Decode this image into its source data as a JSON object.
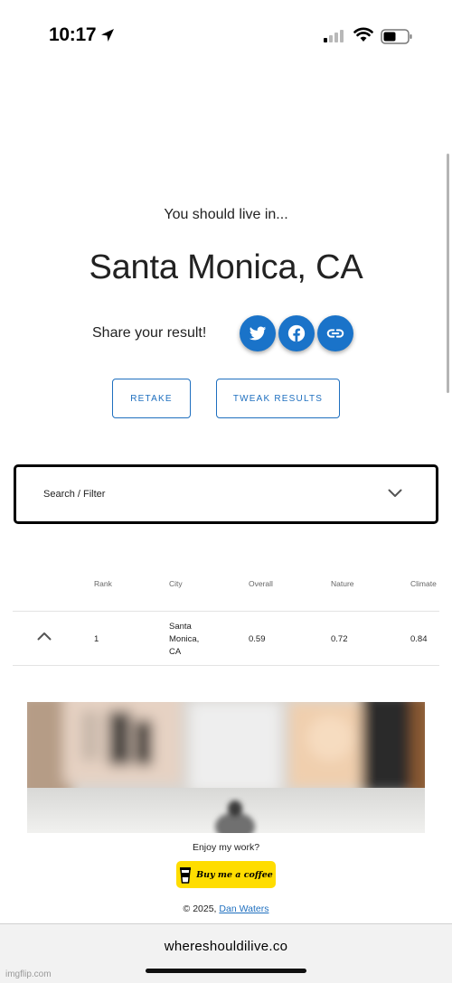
{
  "status_bar": {
    "time": "10:17",
    "icons": [
      "location-arrow-icon",
      "cellular-signal-icon",
      "wifi-icon",
      "battery-icon"
    ]
  },
  "result": {
    "intro": "You should live in...",
    "city": "Santa Monica, CA",
    "share_label": "Share your result!",
    "share_icons": [
      "twitter-icon",
      "facebook-icon",
      "link-icon"
    ],
    "buttons": {
      "retake": "RETAKE",
      "tweak": "TWEAK RESULTS"
    }
  },
  "search": {
    "label": "Search / Filter",
    "icon": "chevron-down-icon"
  },
  "table": {
    "columns": [
      "Rank",
      "City",
      "Overall",
      "Nature",
      "Climate"
    ],
    "rows": [
      {
        "rank": "1",
        "city": [
          "Santa",
          "Monica,",
          "CA"
        ],
        "overall": "0.59",
        "nature": "0.72",
        "climate": "0.84",
        "icon": "chevron-up-icon"
      }
    ]
  },
  "footer": {
    "enjoy": "Enjoy my work?",
    "bmc_label": "Buy me a coffee",
    "bmc_icon": "coffee-cup-icon",
    "copyright_prefix": "© 2025,",
    "author": "Dan Waters"
  },
  "browser": {
    "url": "whereshouldilive.co"
  },
  "watermark": "imgflip.com",
  "colors": {
    "accent": "#1a73c9",
    "bmc_yellow": "#ffdd00",
    "search_border": "#000000"
  }
}
